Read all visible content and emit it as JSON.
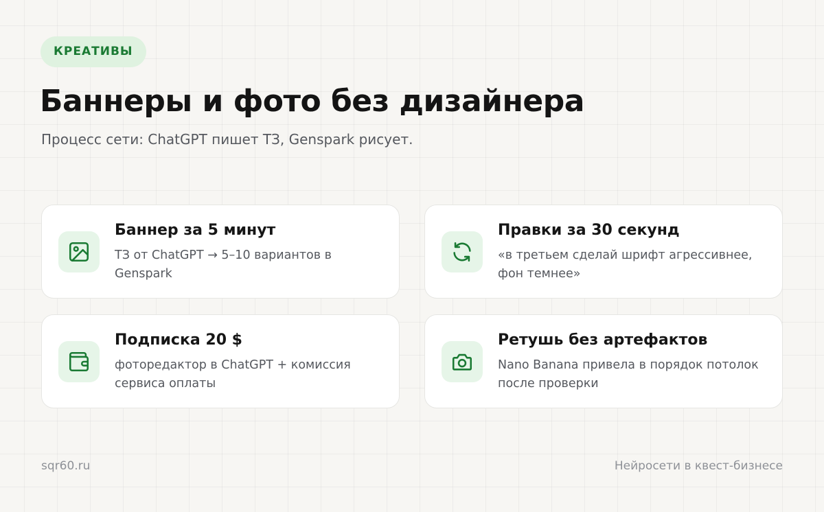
{
  "header": {
    "badge": "КРЕАТИВЫ",
    "title": "Баннеры и фото без дизайнера",
    "subtitle": "Процесс сети: ChatGPT пишет ТЗ, Genspark рисует."
  },
  "cards": [
    {
      "icon": "image-icon",
      "title": "Баннер за 5 минут",
      "description": "ТЗ от ChatGPT → 5–10 вариантов в Genspark"
    },
    {
      "icon": "refresh-icon",
      "title": "Правки за 30 секунд",
      "description": "«в третьем сделай шрифт агрессивнее, фон темнее»"
    },
    {
      "icon": "wallet-icon",
      "title": "Подписка 20 $",
      "description": "фоторедактор в ChatGPT + комиссия сервиса оплаты"
    },
    {
      "icon": "camera-icon",
      "title": "Ретушь без артефактов",
      "description": "Nano Banana привела в порядок потолок после проверки"
    }
  ],
  "footer": {
    "site": "sqr60.ru",
    "caption": "Нейросети в квест-бизнесе"
  },
  "colors": {
    "accent": "#1a7a33",
    "badge_background": "#dff2e0",
    "icon_background": "#e6f5e8",
    "page_background": "#f7f6f3"
  }
}
